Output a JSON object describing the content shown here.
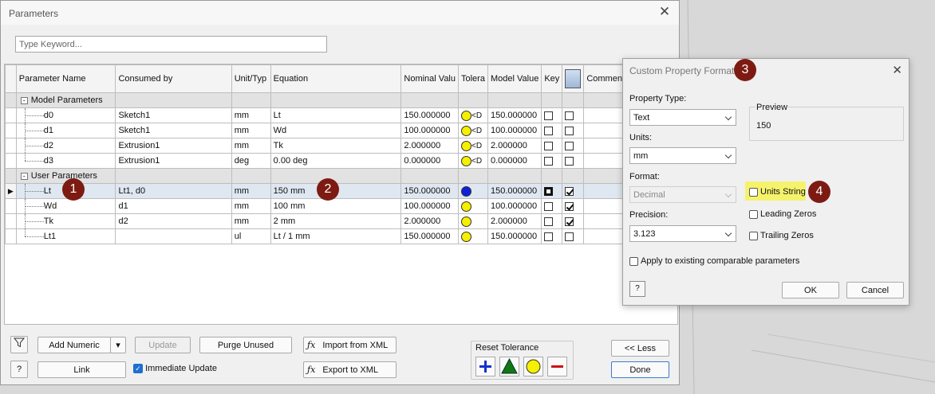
{
  "window": {
    "title": "Parameters"
  },
  "search": {
    "placeholder": "Type Keyword..."
  },
  "columns": [
    "Parameter Name",
    "Consumed by",
    "Unit/Typ",
    "Equation",
    "Nominal Valu",
    "Tolera",
    "Model Value",
    "Key",
    "",
    "Comment"
  ],
  "groups": {
    "model": "Model Parameters",
    "user": "User Parameters"
  },
  "model_rows": [
    {
      "name": "d0",
      "consumed": "Sketch1",
      "unit": "mm",
      "equation": "Lt",
      "nominal": "150.000000",
      "tol": "<D",
      "model": "150.000000"
    },
    {
      "name": "d1",
      "consumed": "Sketch1",
      "unit": "mm",
      "equation": "Wd",
      "nominal": "100.000000",
      "tol": "<D",
      "model": "100.000000"
    },
    {
      "name": "d2",
      "consumed": "Extrusion1",
      "unit": "mm",
      "equation": "Tk",
      "nominal": "2.000000",
      "tol": "<D",
      "model": "2.000000"
    },
    {
      "name": "d3",
      "consumed": "Extrusion1",
      "unit": "deg",
      "equation": "0.00 deg",
      "nominal": "0.000000",
      "tol": "<D",
      "model": "0.000000"
    }
  ],
  "user_rows": [
    {
      "name": "Lt",
      "consumed": "Lt1, d0",
      "unit": "mm",
      "equation": "150 mm",
      "nominal": "150.000000",
      "model": "150.000000"
    },
    {
      "name": "Wd",
      "consumed": "d1",
      "unit": "mm",
      "equation": "100 mm",
      "nominal": "100.000000",
      "model": "100.000000"
    },
    {
      "name": "Tk",
      "consumed": "d2",
      "unit": "mm",
      "equation": "2 mm",
      "nominal": "2.000000",
      "model": "2.000000"
    },
    {
      "name": "Lt1",
      "consumed": "",
      "unit": "ul",
      "equation": "Lt / 1 mm",
      "nominal": "150.000000",
      "model": "150.000000"
    }
  ],
  "markers": {
    "m1": "1",
    "m2": "2",
    "m3": "3",
    "m4": "4"
  },
  "buttons": {
    "add_numeric": "Add Numeric",
    "update": "Update",
    "purge_unused": "Purge Unused",
    "import_xml": "Import from XML",
    "export_xml": "Export to XML",
    "link": "Link",
    "immediate_update": "Immediate Update",
    "reset_tolerance": "Reset Tolerance",
    "less": "<< Less",
    "done": "Done"
  },
  "cpf": {
    "title": "Custom Property Format",
    "property_type_label": "Property Type:",
    "property_type_value": "Text",
    "units_label": "Units:",
    "units_value": "mm",
    "format_label": "Format:",
    "format_value": "Decimal",
    "precision_label": "Precision:",
    "precision_value": "3.123",
    "preview_label": "Preview",
    "preview_value": "150",
    "units_string": "Units String",
    "leading_zeros": "Leading Zeros",
    "trailing_zeros": "Trailing Zeros",
    "apply_existing": "Apply to existing comparable parameters",
    "ok": "OK",
    "cancel": "Cancel"
  },
  "colors": {
    "marker": "#7d1b12",
    "highlight": "#f5f36c",
    "tol_yellow": "#f5ef00",
    "tol_blue": "#0e21d8"
  }
}
